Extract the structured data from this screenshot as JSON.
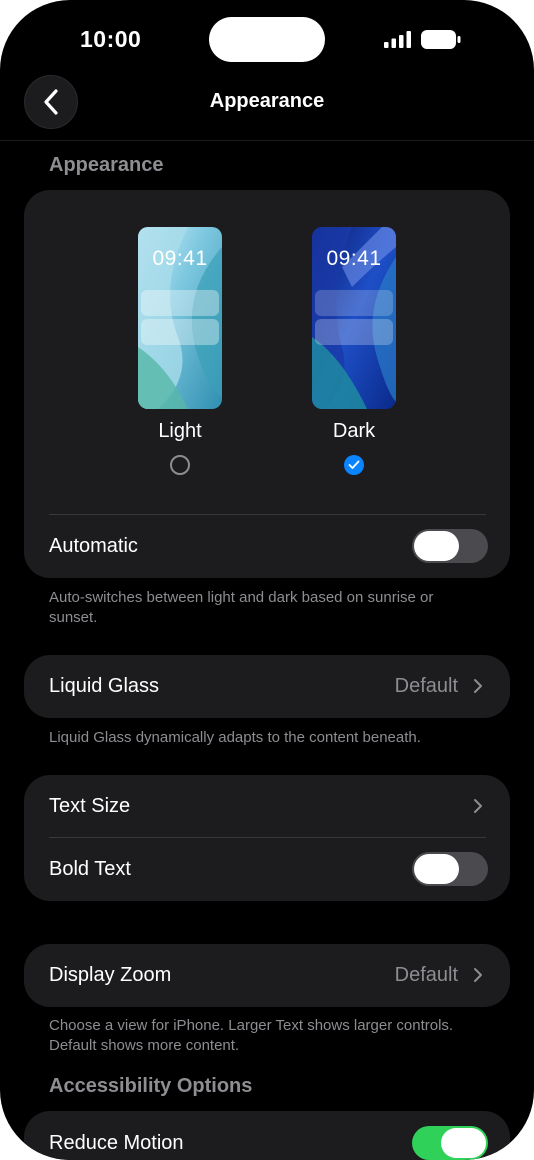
{
  "status_bar": {
    "time": "10:00"
  },
  "nav": {
    "title": "Appearance"
  },
  "sections": {
    "appearance_header": "Appearance",
    "accessibility_header": "Accessibility Options"
  },
  "appearance": {
    "preview_time": "09:41",
    "light_label": "Light",
    "dark_label": "Dark",
    "selected": "Dark",
    "automatic_label": "Automatic",
    "automatic_on": false,
    "automatic_footnote": "Auto-switches between light and dark based on sunrise or sunset."
  },
  "liquid_glass": {
    "label": "Liquid Glass",
    "value": "Default",
    "footnote": "Liquid Glass dynamically adapts to the content beneath."
  },
  "text": {
    "text_size_label": "Text Size",
    "bold_text_label": "Bold Text",
    "bold_text_on": false
  },
  "display_zoom": {
    "label": "Display Zoom",
    "value": "Default",
    "footnote": "Choose a view for iPhone. Larger Text shows larger controls. Default shows more content."
  },
  "accessibility": {
    "reduce_motion_label": "Reduce Motion",
    "reduce_motion_on": true
  },
  "colors": {
    "background": "#000000",
    "card": "#1c1c1e",
    "secondary_text": "#8d8d92",
    "toggle_on": "#30d158",
    "toggle_off": "#4b4b4f",
    "accent": "#0a84ff"
  },
  "icons": [
    "back-chevron-icon",
    "chevron-right-icon",
    "checkmark-icon",
    "signal-icon",
    "battery-icon"
  ]
}
